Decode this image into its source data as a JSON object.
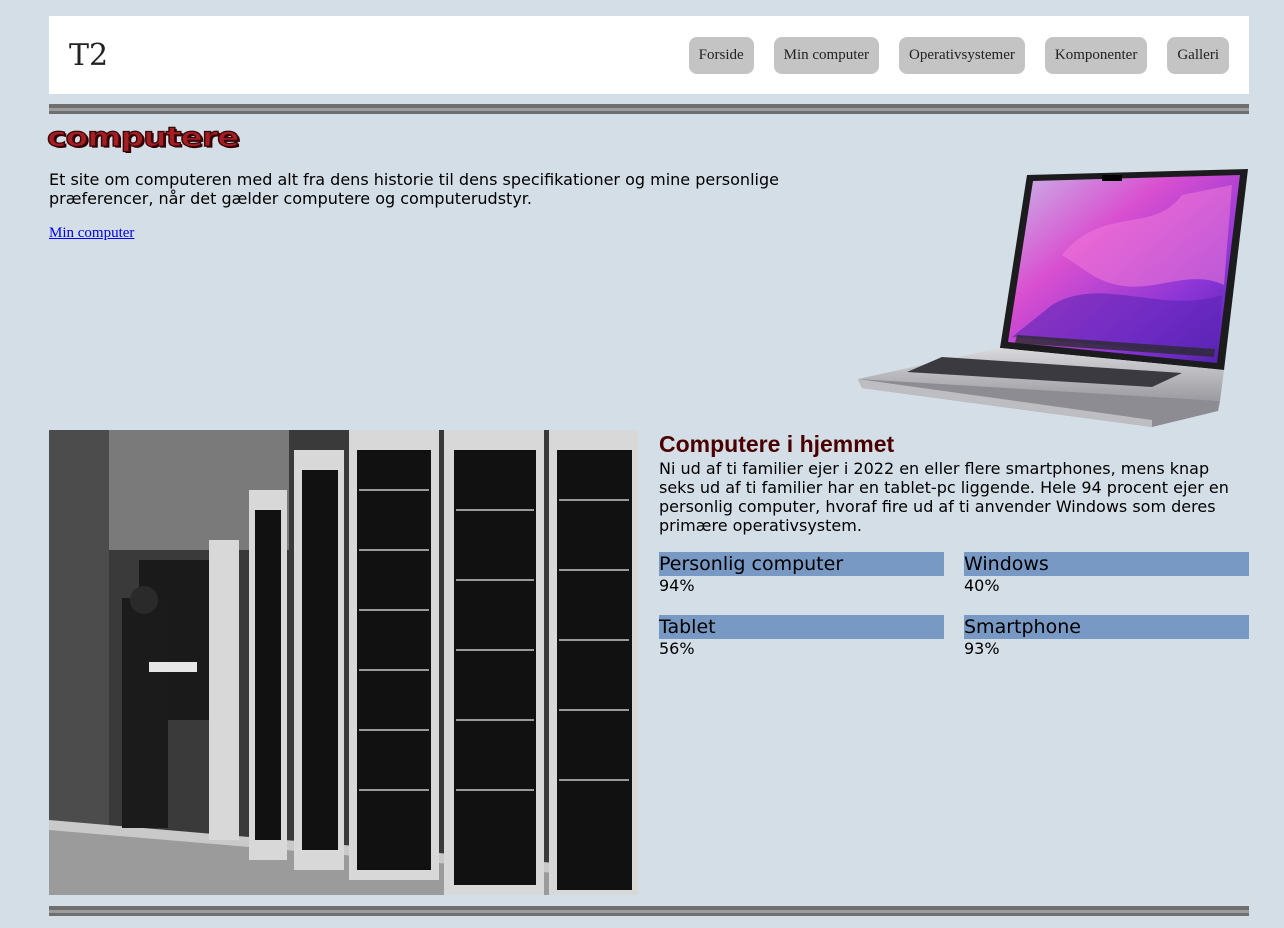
{
  "header": {
    "logo": "T2",
    "nav": [
      {
        "label": "Forside"
      },
      {
        "label": "Min computer"
      },
      {
        "label": "Operativsystemer"
      },
      {
        "label": "Komponenter"
      },
      {
        "label": "Galleri"
      }
    ]
  },
  "intro": {
    "title": "computere",
    "text": "Et site om computeren med alt fra dens historie til dens specifikationer og mine personlige præferencer, når det gælder computere og computerudstyr.",
    "link": "Min computer"
  },
  "stats": {
    "title": "Computere i hjemmet",
    "text": "Ni ud af ti familier ejer i 2022 en eller flere smartphones, mens knap seks ud af ti familier har en tablet-pc liggende. Hele 94 procent ejer en personlig computer, hvoraf fire ud af ti anvender Windows som deres primære operativsystem.",
    "items": [
      {
        "label": "Personlig computer",
        "value": "94%"
      },
      {
        "label": "Windows",
        "value": "40%"
      },
      {
        "label": "Tablet",
        "value": "56%"
      },
      {
        "label": "Smartphone",
        "value": "93%"
      }
    ]
  },
  "colors": {
    "background": "#d3dee7",
    "stat_bar": "#7899c4",
    "heading": "#4a0000",
    "brand": "#a41e24"
  }
}
